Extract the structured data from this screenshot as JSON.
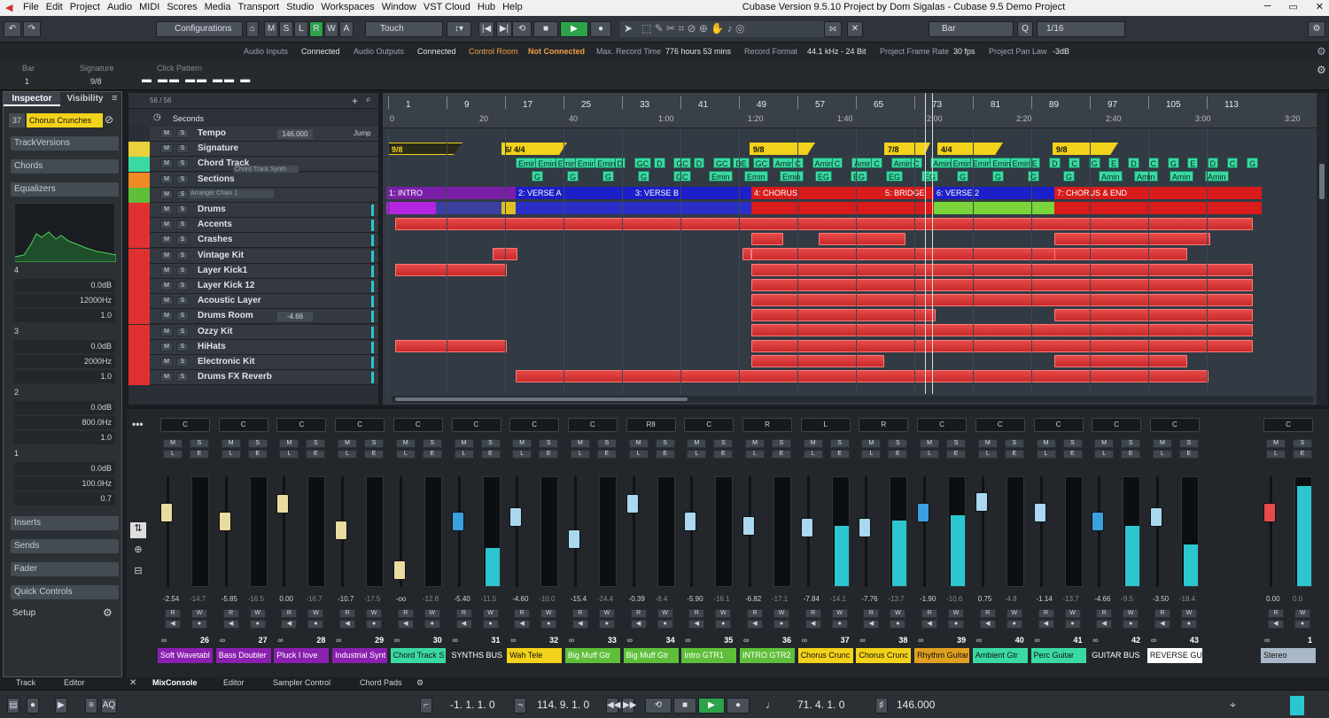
{
  "app": {
    "title": "Cubase Version 9.5.10 Project by Dom Sigalas - Cubase 9.5 Demo Project",
    "menu": [
      "File",
      "Edit",
      "Project",
      "Audio",
      "MIDI",
      "Scores",
      "Media",
      "Transport",
      "Studio",
      "Workspaces",
      "Window",
      "VST Cloud",
      "Hub",
      "Help"
    ]
  },
  "toolbar": {
    "configurations": "Configurations",
    "mode_buttons": [
      "M",
      "S",
      "L",
      "R",
      "W",
      "A"
    ],
    "touch": "Touch",
    "grid": "Bar",
    "quantize": "1/16"
  },
  "status": {
    "audio_inputs_label": "Audio Inputs",
    "audio_inputs": "Connected",
    "audio_outputs_label": "Audio Outputs",
    "audio_outputs": "Connected",
    "control_room_label": "Control Room",
    "control_room": "Not Connected",
    "max_record_label": "Max. Record Time",
    "max_record": "776 hours 53 mins",
    "record_format_label": "Record Format",
    "record_format": "44.1 kHz - 24 Bit",
    "frame_rate_label": "Project Frame Rate",
    "frame_rate": "30 fps",
    "pan_law_label": "Project Pan Law",
    "pan_law": "-3dB"
  },
  "info": {
    "bar_label": "Bar",
    "bar_value": "1",
    "signature_label": "Signature",
    "signature_value": "9/8",
    "click_label": "Click Pattern"
  },
  "inspector": {
    "tab_inspector": "Inspector",
    "tab_visibility": "Visibility",
    "track_num": "37",
    "track_name": "Chorus Crunches",
    "sections": [
      "TrackVersions",
      "Chords",
      "Equalizers"
    ],
    "eq_bands": [
      {
        "n": "4",
        "gain": "0.0dB",
        "freq": "12000Hz",
        "q": "1.0"
      },
      {
        "n": "3",
        "gain": "0.0dB",
        "freq": "2000Hz",
        "q": "1.0"
      },
      {
        "n": "2",
        "gain": "0.0dB",
        "freq": "800.0Hz",
        "q": "1.0"
      },
      {
        "n": "1",
        "gain": "0.0dB",
        "freq": "100.0Hz",
        "q": "0.7"
      }
    ],
    "bottom_sections": [
      "Inserts",
      "Sends",
      "Fader",
      "Quick Controls"
    ],
    "setup": "Setup"
  },
  "tracklist": {
    "count": "56 / 56",
    "time_label": "Seconds",
    "tracks": [
      {
        "name": "Tempo",
        "value": "146.000",
        "extra": "Jump",
        "color": "#2a2f35"
      },
      {
        "name": "Signature",
        "color": "#e8d13a"
      },
      {
        "name": "Chord Track",
        "sub": "Chord Track Synth",
        "color": "#3bd9a2"
      },
      {
        "name": "Sections",
        "color": "#f08a24"
      },
      {
        "name": "",
        "sub": "Arranger Chain 1",
        "color": "#5fbf3a"
      },
      {
        "name": "Drums",
        "color": "#e03030"
      },
      {
        "name": "Accents",
        "color": "#e03030"
      },
      {
        "name": "Crashes",
        "color": "#e03030"
      },
      {
        "name": "Vintage Kit",
        "color": "#e03030"
      },
      {
        "name": "Layer Kick1",
        "color": "#e03030"
      },
      {
        "name": "Layer Kick 12",
        "color": "#e03030"
      },
      {
        "name": "Acoustic Layer",
        "color": "#e03030"
      },
      {
        "name": "Drums Room",
        "value": "-4.66",
        "color": "#e03030"
      },
      {
        "name": "Ozzy Kit",
        "color": "#e03030"
      },
      {
        "name": "HiHats",
        "color": "#e03030"
      },
      {
        "name": "Electronic Kit",
        "color": "#e03030"
      },
      {
        "name": "Drums FX Reverb",
        "color": "#e03030"
      }
    ]
  },
  "ruler": {
    "bars": [
      "1",
      "9",
      "17",
      "25",
      "33",
      "41",
      "49",
      "57",
      "65",
      "73",
      "81",
      "89",
      "97",
      "105",
      "113"
    ],
    "times": [
      "0",
      "20",
      "40",
      "1:00",
      "1:20",
      "1:40",
      "2:00",
      "2:20",
      "2:40",
      "3:00",
      "3:20"
    ]
  },
  "signatures": [
    "9/8",
    "6/ 4/4",
    "9/8",
    "7/8",
    "4/4",
    "9/8"
  ],
  "chords_row1": [
    "Emin",
    "Emin",
    "Emin",
    "Emin",
    "Emin",
    "D",
    "GC",
    "D",
    "GC",
    "D",
    "GC",
    "DE",
    "GC",
    "Amin",
    "C",
    "Amin",
    "C",
    "Amin",
    "C",
    "Amin",
    "C",
    "Amin",
    "Emin",
    "Emin",
    "Emin",
    "Emin",
    "E",
    "D",
    "C",
    "G",
    "E",
    "D",
    "C",
    "G",
    "E",
    "D",
    "C",
    "G"
  ],
  "chords_row2": [
    "G",
    "G",
    "G",
    "G",
    "GC",
    "Emin",
    "Emin",
    "Emin",
    "EG",
    "EG",
    "EG",
    "EG",
    "G",
    "G",
    "G",
    "G",
    "Amin",
    "Amin",
    "Amin",
    "Amin"
  ],
  "sections": [
    {
      "label": "1: INTRO",
      "color": "#7a1fa8"
    },
    {
      "label": "2: VERSE A",
      "color": "#1d1fc8"
    },
    {
      "label": "3: VERSE B",
      "color": "#1d1fc8"
    },
    {
      "label": "4: CHORUS",
      "color": "#d81b1b"
    },
    {
      "label": "5: BRIDGE",
      "color": "#d81b1b"
    },
    {
      "label": "6: VERSE 2",
      "color": "#1d1fc8"
    },
    {
      "label": "7: CHORUS & END",
      "color": "#d81b1b"
    }
  ],
  "mixer": {
    "channels": [
      {
        "pan": "C",
        "num": "26",
        "name": "Soft Wavetabl",
        "color": "#8a1fb0",
        "v1": "-2.54",
        "v2": "-14.7",
        "knob": "#e8dca0",
        "kp": 0.3,
        "m": 0
      },
      {
        "pan": "C",
        "num": "27",
        "name": "Bass Doubler",
        "color": "#8a1fb0",
        "v1": "-5.85",
        "v2": "-16.5",
        "knob": "#e8dca0",
        "kp": 0.4,
        "m": 0
      },
      {
        "pan": "C",
        "num": "28",
        "name": "Pluck I love",
        "color": "#8a1fb0",
        "v1": "0.00",
        "v2": "-16.7",
        "knob": "#e8dca0",
        "kp": 0.2,
        "m": 0
      },
      {
        "pan": "C",
        "num": "29",
        "name": "Industrial Synt",
        "color": "#8a1fb0",
        "v1": "-10.7",
        "v2": "-17.5",
        "knob": "#e8dca0",
        "kp": 0.5,
        "m": 0
      },
      {
        "pan": "C",
        "num": "30",
        "name": "Chord Track S",
        "color": "#3bd9a2",
        "v1": "-oo",
        "v2": "-12.8",
        "knob": "#e8dca0",
        "kp": 0.95,
        "m": 0
      },
      {
        "pan": "C",
        "num": "31",
        "name": "SYNTHS BUS",
        "color": "#23272c",
        "v1": "-5.40",
        "v2": "-11.5",
        "knob": "#3aa0e0",
        "kp": 0.4,
        "m": 0.35
      },
      {
        "pan": "C",
        "num": "32",
        "name": "Wah Tele",
        "color": "#f2d21a",
        "v1": "-4.60",
        "v2": "-10.0",
        "knob": "#a9d8f0",
        "kp": 0.35,
        "m": 0
      },
      {
        "pan": "C",
        "num": "33",
        "name": "Big Muff Gtr",
        "color": "#5fbf3a",
        "v1": "-15.4",
        "v2": "-24.4",
        "knob": "#a9d8f0",
        "kp": 0.6,
        "m": 0
      },
      {
        "pan": "R8",
        "num": "34",
        "name": "Big Muff Gtr",
        "color": "#5fbf3a",
        "v1": "-0.39",
        "v2": "-8.4",
        "knob": "#a9d8f0",
        "kp": 0.2,
        "m": 0
      },
      {
        "pan": "C",
        "num": "35",
        "name": "Intro GTR1",
        "color": "#5fbf3a",
        "v1": "-5.90",
        "v2": "-16.1",
        "knob": "#a9d8f0",
        "kp": 0.4,
        "m": 0
      },
      {
        "pan": "R",
        "num": "36",
        "name": "INTRO GTR2",
        "color": "#5fbf3a",
        "v1": "-6.82",
        "v2": "-17.1",
        "knob": "#a9d8f0",
        "kp": 0.45,
        "m": 0
      },
      {
        "pan": "L",
        "num": "37",
        "name": "Chorus Crunc",
        "color": "#f2d21a",
        "v1": "-7.84",
        "v2": "-14.1",
        "knob": "#a9d8f0",
        "kp": 0.47,
        "m": 0.55
      },
      {
        "pan": "R",
        "num": "38",
        "name": "Chorus Crunc",
        "color": "#f2d21a",
        "v1": "-7.76",
        "v2": "-13.7",
        "knob": "#a9d8f0",
        "kp": 0.47,
        "m": 0.6
      },
      {
        "pan": "C",
        "num": "39",
        "name": "Rhythm Guitar",
        "color": "#e0a020",
        "v1": "-1.90",
        "v2": "-10.6",
        "knob": "#3aa0e0",
        "kp": 0.3,
        "m": 0.65
      },
      {
        "pan": "C",
        "num": "40",
        "name": "Ambient Gtr",
        "color": "#3bd9a2",
        "v1": "0.75",
        "v2": "-4.8",
        "knob": "#a9d8f0",
        "kp": 0.18,
        "m": 0
      },
      {
        "pan": "C",
        "num": "41",
        "name": "Perc Guitar",
        "color": "#3bd9a2",
        "v1": "-1.14",
        "v2": "-13.7",
        "knob": "#a9d8f0",
        "kp": 0.3,
        "m": 0
      },
      {
        "pan": "C",
        "num": "42",
        "name": "GUITAR BUS",
        "color": "#23272c",
        "v1": "-4.66",
        "v2": "-9.5",
        "knob": "#3aa0e0",
        "kp": 0.4,
        "m": 0.55
      },
      {
        "pan": "C",
        "num": "43",
        "name": "REVERSE GUIT",
        "color": "#ffffff",
        "v1": "-3.50",
        "v2": "-18.4",
        "knob": "#a9d8f0",
        "kp": 0.35,
        "m": 0.38
      }
    ],
    "master": {
      "pan": "C",
      "num": "1",
      "name": "Stereo",
      "color": "#a9b8c6",
      "v1": "0.00",
      "v2": "0.0"
    }
  },
  "bottom_tabs": {
    "track": "Track",
    "editor": "Editor",
    "mixconsole": "MixConsole",
    "editor2": "Editor",
    "sampler": "Sampler Control",
    "chordpads": "Chord Pads"
  },
  "transport": {
    "left_locator": "-1. 1. 1.   0",
    "right_locator": "114. 9. 1.   0",
    "position": "71. 4. 1.   0",
    "tempo": "146.000"
  }
}
